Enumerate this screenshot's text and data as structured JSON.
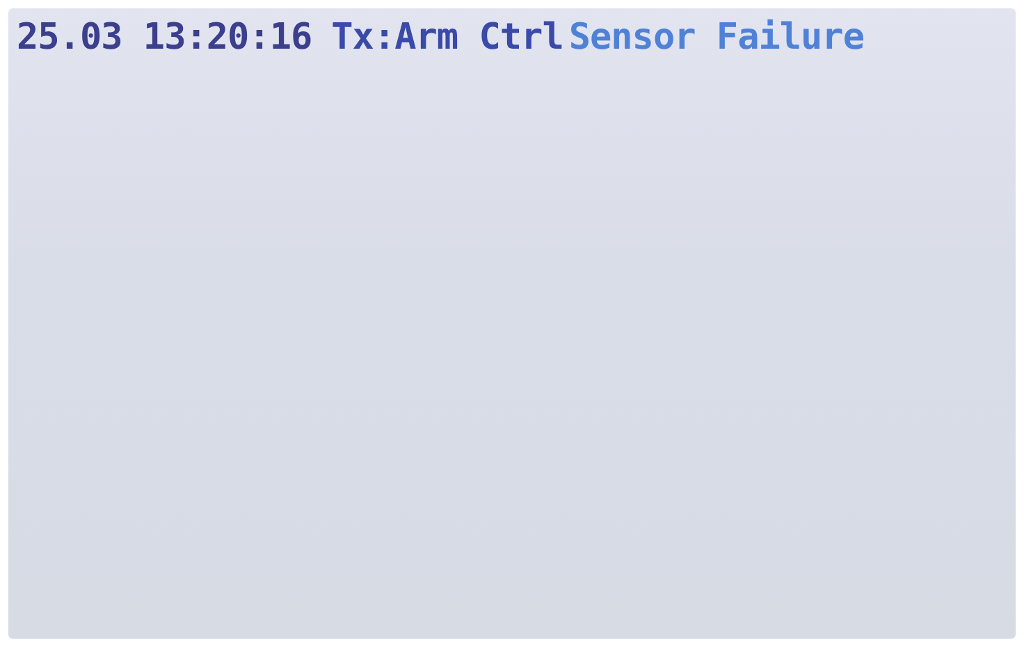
{
  "status_line": {
    "timestamp": "25.03 13:20:16",
    "source": "Tx:Arm Ctrl",
    "message": "Sensor Failure"
  }
}
